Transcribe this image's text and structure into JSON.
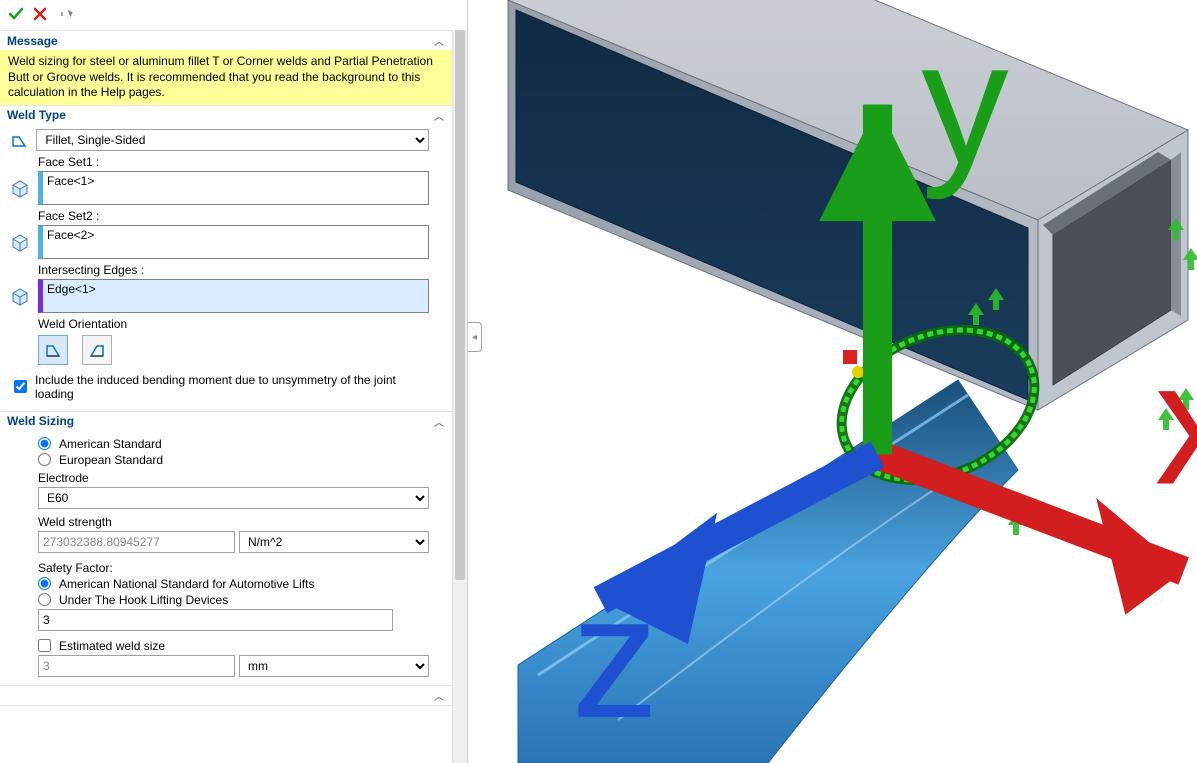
{
  "sections": {
    "message": {
      "title": "Message",
      "text": "Weld sizing for steel or aluminum fillet T or Corner welds and Partial Penetration Butt or Groove welds. It is recommended that you read the background to this calculation in the Help pages."
    },
    "weld_type": {
      "title": "Weld Type",
      "type_selected": "Fillet, Single-Sided",
      "face_set1_label": "Face Set1 :",
      "face_set1_value": "Face<1>",
      "face_set2_label": "Face Set2 :",
      "face_set2_value": "Face<2>",
      "inter_edges_label": "Intersecting Edges :",
      "inter_edges_value": "Edge<1>",
      "orientation_label": "Weld Orientation",
      "include_bending_label": "Include the induced bending moment due to unsymmetry of the joint loading"
    },
    "weld_sizing": {
      "title": "Weld Sizing",
      "american_label": "American Standard",
      "european_label": "European Standard",
      "electrode_label": "Electrode",
      "electrode_value": "E60",
      "strength_label": "Weld strength",
      "strength_value": "273032388.80945277",
      "strength_unit": "N/m^2",
      "safety_label": "Safety Factor:",
      "safety_opt1": "American National Standard for Automotive Lifts",
      "safety_opt2": "Under The Hook Lifting Devices",
      "safety_value": "3",
      "est_size_label": "Estimated weld size",
      "est_size_value": "3",
      "est_size_unit": "mm"
    }
  },
  "booleans": {
    "include_bending": true,
    "american": true,
    "safety_auto": true,
    "est_size_checked": false
  }
}
